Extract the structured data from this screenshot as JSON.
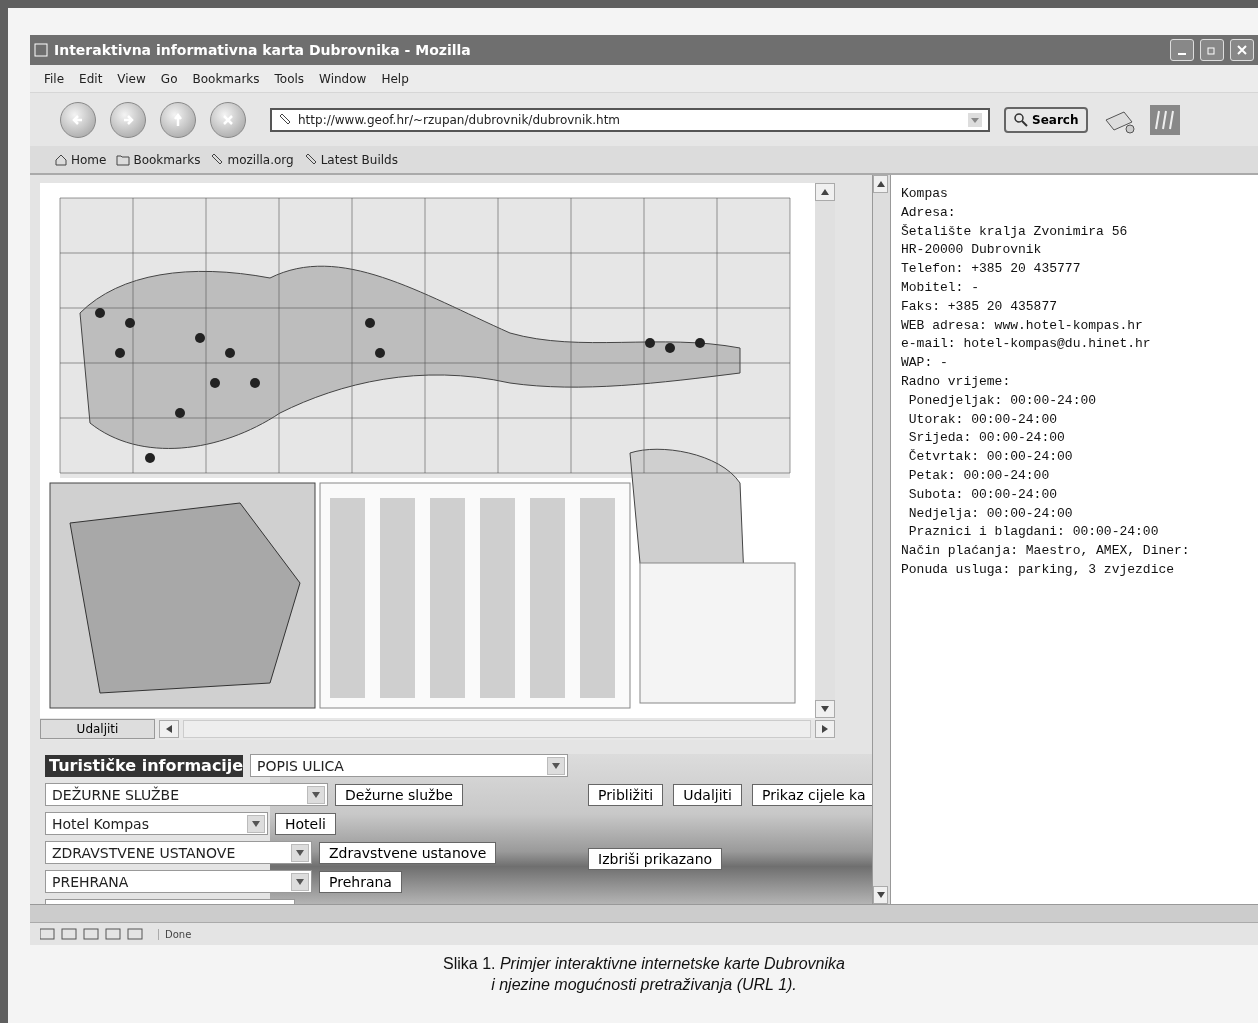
{
  "window": {
    "title": "Interaktivna informativna karta Dubrovnika - Mozilla"
  },
  "menu": [
    "File",
    "Edit",
    "View",
    "Go",
    "Bookmarks",
    "Tools",
    "Window",
    "Help"
  ],
  "navigation": {
    "url": "http://www.geof.hr/~rzupan/dubrovnik/dubrovnik.htm",
    "search_button": "Search"
  },
  "bookmarks": [
    {
      "label": "Home",
      "kind": "home"
    },
    {
      "label": "Bookmarks",
      "kind": "folder"
    },
    {
      "label": "mozilla.org",
      "kind": "link"
    },
    {
      "label": "Latest Builds",
      "kind": "link"
    }
  ],
  "map_frame": {
    "zoom_out_button": "Udaljiti"
  },
  "form": {
    "heading": "Turističke informacije",
    "street_select": "POPIS ULICA",
    "rows": [
      {
        "select": "DEŽURNE SLUŽBE",
        "button": "Dežurne službe"
      },
      {
        "select": "Hotel Kompas",
        "button": "Hoteli"
      },
      {
        "select": "ZDRAVSTVENE USTANOVE",
        "button": "Zdravstvene ustanove"
      },
      {
        "select": "PREHRANA",
        "button": "Prehrana"
      }
    ],
    "view_buttons": [
      "Približiti",
      "Udaljiti",
      "Prikaz cijele ka"
    ],
    "clear_button": "Izbriši prikazano"
  },
  "details": [
    "Kompas",
    "Adresa:",
    "Šetalište kralja Zvonimira 56",
    "HR-20000 Dubrovnik",
    "Telefon: +385 20 435777",
    "Mobitel: -",
    "Faks: +385 20 435877",
    "WEB adresa: www.hotel-kompas.hr",
    "e-mail: hotel-kompas@du.hinet.hr",
    "WAP: -",
    "Radno vrijeme:",
    " Ponedjeljak: 00:00-24:00",
    " Utorak: 00:00-24:00",
    " Srijeda: 00:00-24:00",
    " Četvrtak: 00:00-24:00",
    " Petak: 00:00-24:00",
    " Subota: 00:00-24:00",
    " Nedjelja: 00:00-24:00",
    " Praznici i blagdani: 00:00-24:00",
    "Način plaćanja: Maestro, AMEX, Diner:",
    "Ponuda usluga: parking, 3 zvjezdice"
  ],
  "status_bar": {
    "text": "Done"
  },
  "caption": [
    "Slika 1. *Primjer interaktivne internetske karte Dubrovnika*",
    "*i njezine mogućnosti pretraživanja (URL 1).*"
  ]
}
